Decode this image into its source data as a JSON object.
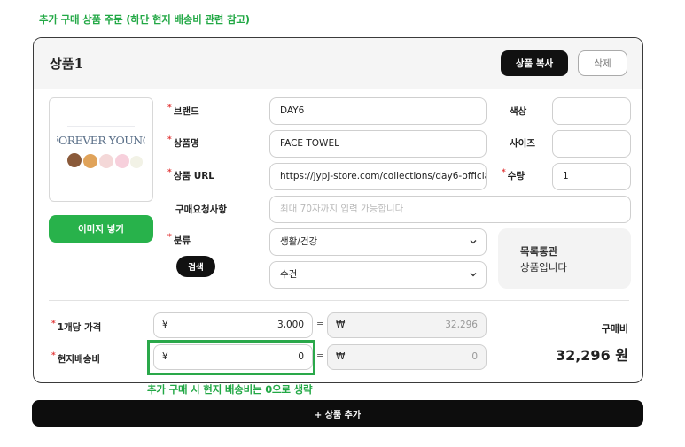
{
  "top_note": "추가 구매 상품 주문 (하단 현지 배송비 관련 참고)",
  "product": {
    "title": "상품1",
    "copy_label": "상품 복사",
    "delete_label": "삭제",
    "image_button_label": "이미지 넣기",
    "thumbnail_text": "FOREVER YOUNG",
    "required_mark": "*",
    "fields": {
      "brand": {
        "label": "브랜드",
        "value": "DAY6"
      },
      "name": {
        "label": "상품명",
        "value": "FACE TOWEL"
      },
      "url": {
        "label": "상품 URL",
        "value": "https://jypj-store.com/collections/day6-officia"
      },
      "request": {
        "label": "구매요청사항",
        "placeholder": "최대 70자까지 입력 가능합니다"
      },
      "category": {
        "label": "분류",
        "value": "생활/건강",
        "sub_value": "수건"
      },
      "search_label": "검색",
      "color": {
        "label": "색상",
        "value": ""
      },
      "size": {
        "label": "사이즈",
        "value": ""
      },
      "quantity": {
        "label": "수량",
        "value": "1"
      }
    },
    "notice": {
      "line1": "목록통관",
      "line2": "상품입니다"
    },
    "pricing": {
      "unit_price": {
        "label": "1개당 가격",
        "currency": "¥",
        "value": "3,000",
        "krw_currency": "₩",
        "krw_value": "32,296"
      },
      "local_shipping": {
        "label": "현지배송비",
        "currency": "¥",
        "value": "0",
        "krw_currency": "₩",
        "krw_value": "0"
      },
      "equals": "=",
      "total_label": "구매비",
      "total_value": "32,296 원"
    }
  },
  "bottom_note": "추가 구매 시 현지 배송비는 0으로 생략",
  "add_button_label": "+ 상품 추가",
  "colors": {
    "accent_green": "#28b24b",
    "required_red": "#e23b3b",
    "dark": "#111111"
  }
}
